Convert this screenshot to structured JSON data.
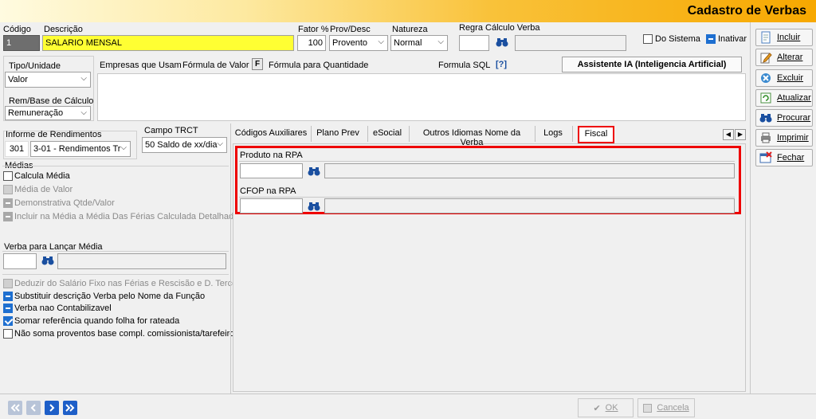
{
  "window": {
    "title": "Cadastro de Verbas"
  },
  "header": {
    "codigo_label": "Código",
    "codigo_value": "1",
    "descricao_label": "Descrição",
    "descricao_value": "SALARIO MENSAL",
    "fator_label": "Fator %",
    "fator_value": "100",
    "provdesc_label": "Prov/Desc",
    "provdesc_value": "Provento",
    "natureza_label": "Natureza",
    "natureza_value": "Normal",
    "regra_label": "Regra Cálculo Verba",
    "regra_value": "",
    "do_sistema_label": "Do Sistema",
    "inativar_label": "Inativar"
  },
  "left": {
    "tipo_label": "Tipo/Unidade",
    "tipo_value": "Valor",
    "rem_label": "Rem/Base de Cálculo",
    "rem_value": "Remuneração"
  },
  "toptabs": {
    "empresas": "Empresas que Usam",
    "formula_valor": "Fórmula de Valor",
    "f_badge": "F",
    "formula_qtd": "Fórmula para Quantidade",
    "formula_sql": "Formula SQL",
    "sql_badge": "[?]",
    "assistente": "Assistente IA (Inteligencia Artificial)"
  },
  "informe": {
    "label": "Informe de Rendimentos",
    "code": "301",
    "value": "3-01 - Rendimentos Tr",
    "trct_label": "Campo TRCT",
    "trct_value": "50 Saldo de xx/dia"
  },
  "medias": {
    "label": "Médias",
    "items": [
      "Calcula Média",
      "Média de Valor",
      "Demonstrativa Qtde/Valor",
      "Incluir na Média a Média Das Férias Calculada Detalhada"
    ]
  },
  "verba_media": {
    "label": "Verba para Lançar Média",
    "value": ""
  },
  "options": [
    "Deduzir do Salário Fixo nas  Férias e Rescisão e D. Terceiro",
    "Substituir descrição Verba pelo Nome da Função",
    "Verba nao Contabilizavel",
    "Somar referência quando folha for rateada",
    "Não soma proventos base compl. comissionista/tarefeiro"
  ],
  "tabs": [
    "Códigos Auxiliares",
    "Plano Prev",
    "eSocial",
    "Outros Idiomas Nome da Verba",
    "Logs",
    "Fiscal"
  ],
  "fiscal": {
    "produto_label": "Produto na RPA",
    "cfop_label": "CFOP na RPA"
  },
  "side_buttons": [
    "Incluir",
    "Alterar",
    "Excluir",
    "Atualizar",
    "Procurar",
    "Imprimir",
    "Fechar"
  ],
  "footer": {
    "ok": "OK",
    "cancela": "Cancela"
  },
  "colors": {
    "highlight": "#ff0000",
    "yellow_field": "#ffff33",
    "accent": "#1e6fd0"
  }
}
